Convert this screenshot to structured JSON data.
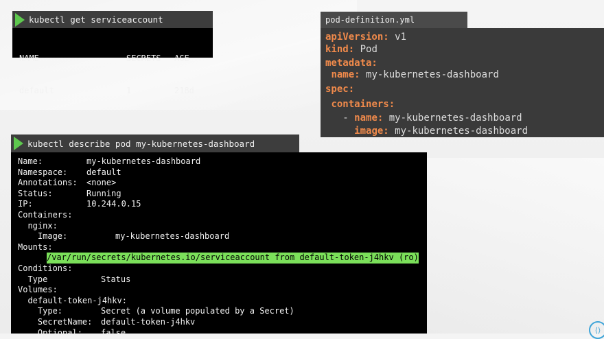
{
  "top_terminal": {
    "command": "kubectl get serviceaccount",
    "headers": [
      "NAME",
      "SECRETS",
      "AGE"
    ],
    "rows": [
      [
        "default",
        "1",
        "218d"
      ]
    ]
  },
  "pod_definition": {
    "filename": "pod-definition.yml",
    "lines": [
      {
        "indent": "",
        "key": "apiVersion:",
        "value": " v1"
      },
      {
        "indent": "",
        "key": "kind:",
        "value": " Pod"
      },
      {
        "indent": "",
        "key": "metadata:",
        "value": ""
      },
      {
        "indent": " ",
        "key": "name:",
        "value": " my-kubernetes-dashboard"
      },
      {
        "indent": "",
        "key": "spec:",
        "value": ""
      },
      {
        "indent": " ",
        "key": "containers:",
        "value": ""
      },
      {
        "indent": "   - ",
        "key": "name:",
        "value": " my-kubernetes-dashboard"
      },
      {
        "indent": "     ",
        "key": "image:",
        "value": " my-kubernetes-dashboard"
      }
    ]
  },
  "describe_terminal": {
    "command": "kubectl describe pod my-kubernetes-dashboard",
    "lines": [
      {
        "label": "Name:",
        "value": "my-kubernetes-dashboard"
      },
      {
        "label": "Namespace:",
        "value": "default"
      },
      {
        "label": "Annotations:",
        "value": "<none>"
      },
      {
        "label": "Status:",
        "value": "Running"
      },
      {
        "label": "IP:",
        "value": "10.244.0.15"
      },
      {
        "label": "Containers:",
        "value": ""
      },
      {
        "label": "  nginx:",
        "value": ""
      },
      {
        "label": "    Image:",
        "value": "my-kubernetes-dashboard"
      },
      {
        "label": "Mounts:",
        "value": ""
      },
      {
        "label": "",
        "value": "/var/run/secrets/kubernetes.io/serviceaccount from default-token-j4hkv (ro)",
        "highlight": true
      },
      {
        "label": "Conditions:",
        "value": ""
      },
      {
        "label": "  Type",
        "value": "Status"
      },
      {
        "label": "Volumes:",
        "value": ""
      },
      {
        "label": "  default-token-j4hkv:",
        "value": ""
      },
      {
        "label": "    Type:",
        "value": "Secret (a volume populated by a Secret)"
      },
      {
        "label": "    SecretName:",
        "value": "default-token-j4hkv"
      },
      {
        "label": "    Optional:",
        "value": "false"
      }
    ]
  },
  "icons": {
    "play": "play-icon",
    "corner": "settings-icon"
  },
  "colors": {
    "play": "#5ec84e",
    "highlight": "#7be05a",
    "yaml_key": "#f08a4b"
  }
}
